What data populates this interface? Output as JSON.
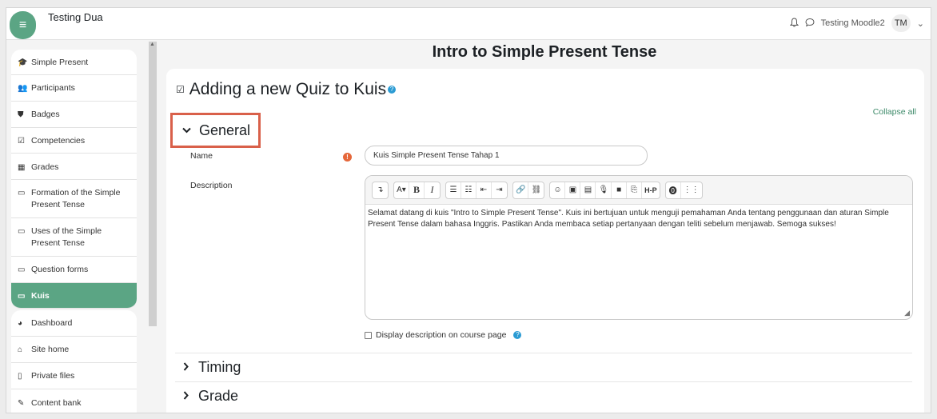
{
  "header": {
    "site_name": "Testing Dua",
    "menu_icon": "≡",
    "bell_icon": "♫",
    "chat_icon": "◯",
    "user_name": "Testing Moodle2",
    "user_initials": "TM",
    "caret": "⌄"
  },
  "sidebar": {
    "items": [
      {
        "label": "Simple Present",
        "icon": "🎓",
        "icon_name": "graduation-cap-icon"
      },
      {
        "label": "Participants",
        "icon": "👥",
        "icon_name": "users-icon"
      },
      {
        "label": "Badges",
        "icon": "⛊",
        "icon_name": "shield-icon"
      },
      {
        "label": "Competencies",
        "icon": "☑",
        "icon_name": "check-square-icon"
      },
      {
        "label": "Grades",
        "icon": "▦",
        "icon_name": "table-icon"
      },
      {
        "label": "Formation of the Simple Present Tense",
        "icon": "▭",
        "icon_name": "folder-icon"
      },
      {
        "label": "Uses of the Simple Present Tense",
        "icon": "▭",
        "icon_name": "folder-icon"
      },
      {
        "label": "Question forms",
        "icon": "▭",
        "icon_name": "folder-icon"
      },
      {
        "label": "Kuis",
        "icon": "▭",
        "icon_name": "folder-icon"
      },
      {
        "label": "Dashboard",
        "icon": "◕",
        "icon_name": "dashboard-icon"
      },
      {
        "label": "Site home",
        "icon": "⌂",
        "icon_name": "home-icon"
      },
      {
        "label": "Private files",
        "icon": "▯",
        "icon_name": "file-icon"
      },
      {
        "label": "Content bank",
        "icon": "✎",
        "icon_name": "brush-icon"
      }
    ]
  },
  "main": {
    "page_title": "Intro to Simple Present Tense",
    "heading": "Adding a new Quiz to Kuis",
    "heading_icon": "☑",
    "help_icon": "?",
    "collapse_all": "Collapse all",
    "general_label": "General",
    "chevron_down": "⌄",
    "chevron_right": "›",
    "name_label": "Name",
    "required_icon": "!",
    "name_value": "Kuis Simple Present Tense Tahap 1",
    "description_label": "Description",
    "description_text": "Selamat datang di kuis \"Intro to Simple Present Tense\". Kuis ini bertujuan untuk menguji pemahaman Anda tentang penggunaan dan aturan Simple Present Tense dalam bahasa Inggris. Pastikan Anda membaca setiap pertanyaan dengan teliti sebelum menjawab. Semoga sukses!",
    "display_description_label": "Display description on course page",
    "timing_label": "Timing",
    "grade_label": "Grade"
  },
  "toolbar": {
    "groups": [
      [
        {
          "label": "↴",
          "name": "collapse-toolbar-icon"
        }
      ],
      [
        {
          "label": "A▾",
          "name": "paragraph-styles-button"
        },
        {
          "label": "B",
          "name": "bold-button",
          "cls": "b"
        },
        {
          "label": "I",
          "name": "italic-button",
          "cls": "i"
        }
      ],
      [
        {
          "label": "☰",
          "name": "unordered-list-icon"
        },
        {
          "label": "☷",
          "name": "ordered-list-icon"
        },
        {
          "label": "⇤",
          "name": "outdent-icon"
        },
        {
          "label": "⇥",
          "name": "indent-icon"
        }
      ],
      [
        {
          "label": "🔗",
          "name": "link-icon"
        },
        {
          "label": "⛓",
          "name": "unlink-icon"
        }
      ],
      [
        {
          "label": "☺",
          "name": "emoji-icon"
        },
        {
          "label": "▣",
          "name": "image-icon"
        },
        {
          "label": "▤",
          "name": "media-icon"
        },
        {
          "label": "🎙",
          "name": "record-audio-icon"
        },
        {
          "label": "■",
          "name": "record-video-icon"
        },
        {
          "label": "⎘",
          "name": "manage-files-icon"
        },
        {
          "label": "H-P",
          "name": "h5p-button",
          "cls": "h5p"
        }
      ],
      [
        {
          "label": "⓿",
          "name": "accessibility-checker-icon"
        },
        {
          "label": "⋮⋮",
          "name": "screenreader-helper-icon"
        }
      ]
    ]
  },
  "colors": {
    "accent": "#5ba584",
    "highlight_border": "#d9604a",
    "required": "#e5673a",
    "help": "#2b9bd3"
  }
}
